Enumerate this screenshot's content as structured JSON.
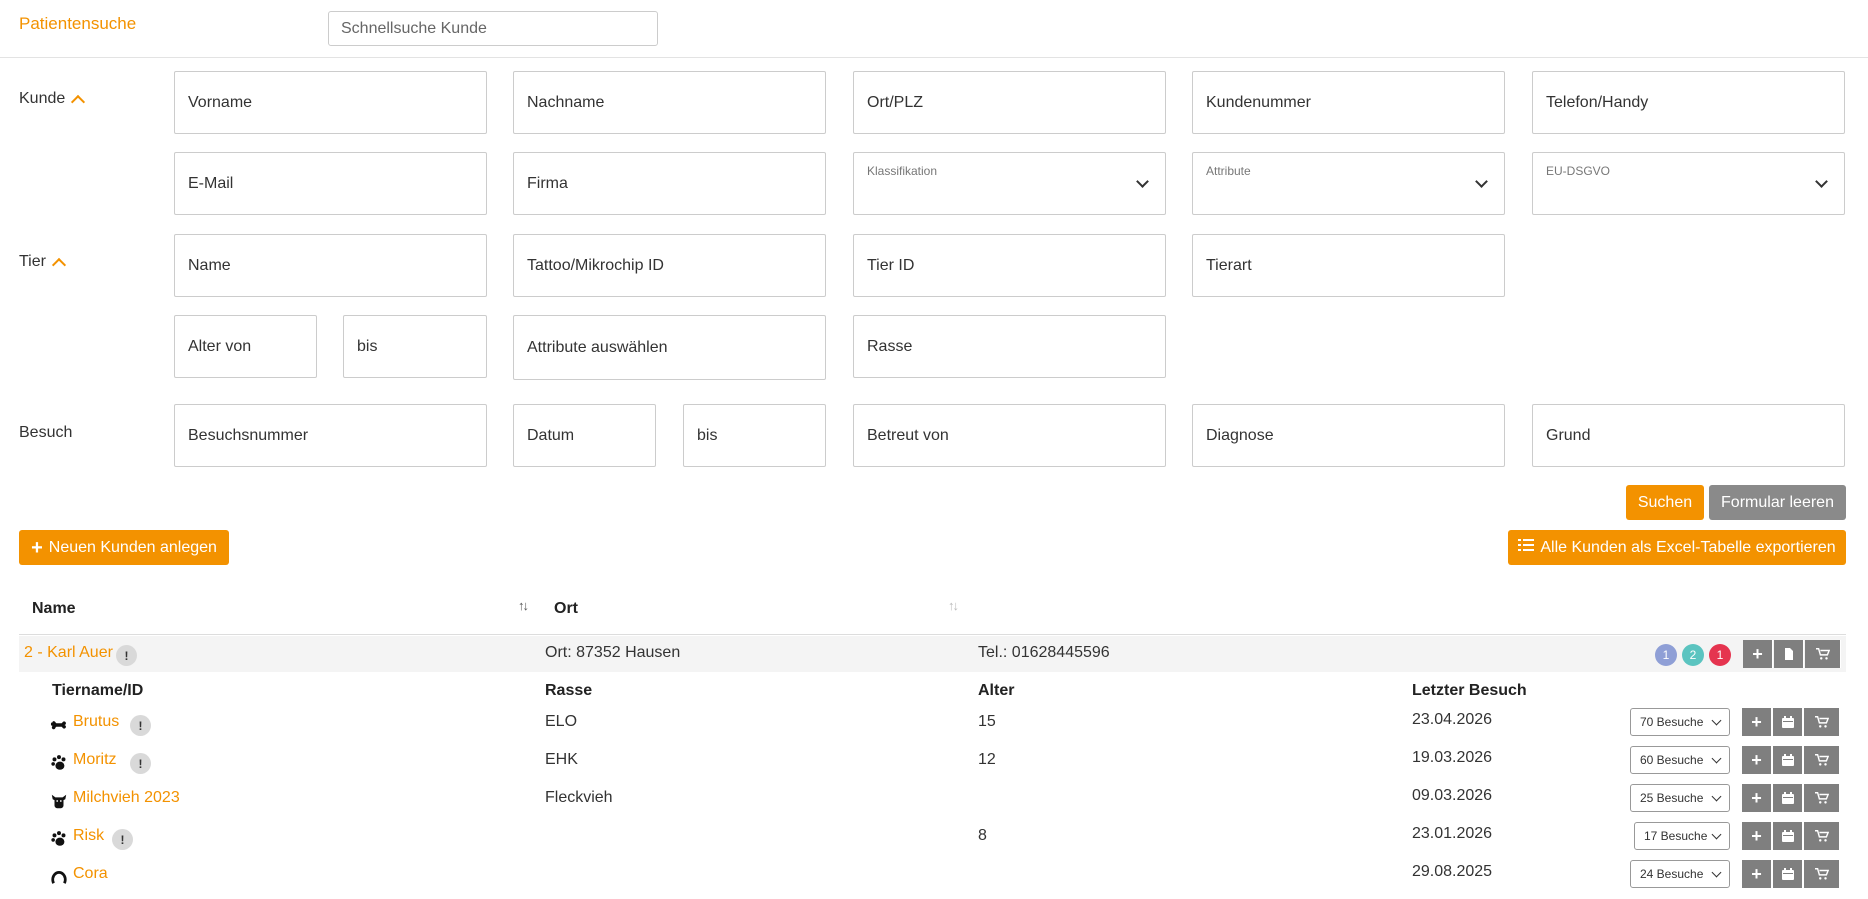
{
  "header": {
    "title": "Patientensuche",
    "quick_search_placeholder": "Schnellsuche Kunde"
  },
  "sections": {
    "kunde": "Kunde",
    "tier": "Tier",
    "besuch": "Besuch"
  },
  "kunde_fields": {
    "vorname": "Vorname",
    "nachname": "Nachname",
    "ort_plz": "Ort/PLZ",
    "kundennummer": "Kundenummer",
    "telefon": "Telefon/Handy",
    "email": "E-Mail",
    "firma": "Firma",
    "klassifikation": "Klassifikation",
    "attribute": "Attribute",
    "eu_dsgvo": "EU-DSGVO"
  },
  "tier_fields": {
    "name": "Name",
    "chip": "Tattoo/Mikrochip ID",
    "tier_id": "Tier ID",
    "tierart": "Tierart",
    "alter_von": "Alter von",
    "alter_bis": "bis",
    "attribute": "Attribute auswählen",
    "rasse": "Rasse"
  },
  "besuch_fields": {
    "besuchsnummer": "Besuchsnummer",
    "datum": "Datum",
    "datum_bis": "bis",
    "betreut_von": "Betreut von",
    "diagnose": "Diagnose",
    "grund": "Grund"
  },
  "actions": {
    "search": "Suchen",
    "clear": "Formular leeren",
    "new_customer": "Neuen Kunden anlegen",
    "export": "Alle Kunden als Excel-Tabelle exportieren"
  },
  "table": {
    "col_name": "Name",
    "col_ort": "Ort",
    "customer": {
      "name": "2 - Karl Auer",
      "ort_label": "Ort:",
      "ort_value": "87352 Hausen",
      "tel_label": "Tel.:",
      "tel_value": "01628445596",
      "badges": [
        "1",
        "2",
        "1"
      ]
    },
    "pet_headers": {
      "name": "Tiername/ID",
      "rasse": "Rasse",
      "alter": "Alter",
      "letzter_besuch": "Letzter Besuch"
    },
    "pets": [
      {
        "icon": "bone-icon",
        "name": "Brutus",
        "rasse": "ELO",
        "alter": "15",
        "last_visit": "23.04.2026",
        "visits": "70 Besuche",
        "info": true
      },
      {
        "icon": "paw-icon",
        "name": "Moritz",
        "rasse": "EHK",
        "alter": "12",
        "last_visit": "19.03.2026",
        "visits": "60 Besuche",
        "info": true
      },
      {
        "icon": "cow-icon",
        "name": "Milchvieh 2023",
        "rasse": "Fleckvieh",
        "alter": "",
        "last_visit": "09.03.2026",
        "visits": "25 Besuche",
        "info": false
      },
      {
        "icon": "paw-icon",
        "name": "Risk",
        "rasse": "",
        "alter": "8",
        "last_visit": "23.01.2026",
        "visits": "17 Besuche",
        "info": true
      },
      {
        "icon": "horseshoe-icon",
        "name": "Cora",
        "rasse": "",
        "alter": "",
        "last_visit": "29.08.2025",
        "visits": "24 Besuche",
        "info": false
      }
    ]
  },
  "colors": {
    "accent": "#f39200",
    "badge_1": "#8f9fd6",
    "badge_2": "#5bc4c0",
    "badge_3": "#e5344f",
    "action_gray": "#7f7f7f"
  }
}
